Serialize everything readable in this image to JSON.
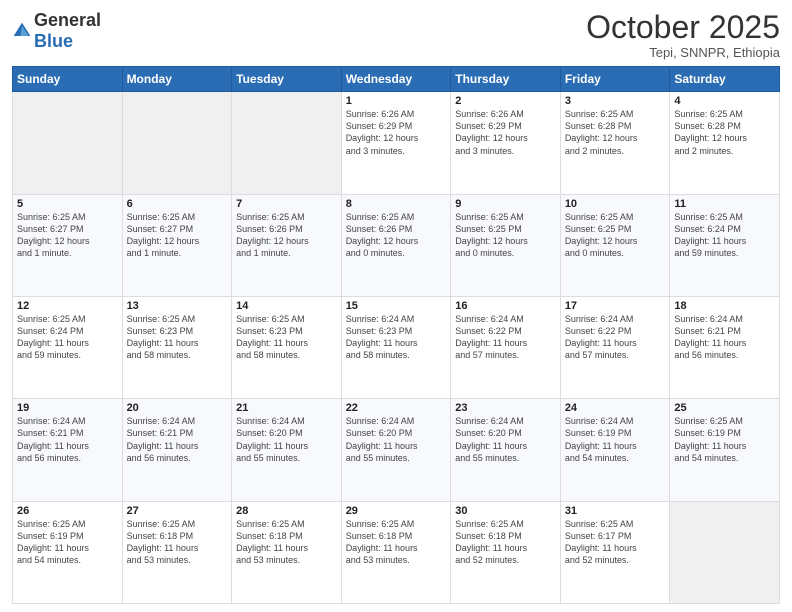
{
  "logo": {
    "general": "General",
    "blue": "Blue"
  },
  "header": {
    "month": "October 2025",
    "location": "Tepi, SNNPR, Ethiopia"
  },
  "days_of_week": [
    "Sunday",
    "Monday",
    "Tuesday",
    "Wednesday",
    "Thursday",
    "Friday",
    "Saturday"
  ],
  "weeks": [
    [
      {
        "day": "",
        "info": ""
      },
      {
        "day": "",
        "info": ""
      },
      {
        "day": "",
        "info": ""
      },
      {
        "day": "1",
        "info": "Sunrise: 6:26 AM\nSunset: 6:29 PM\nDaylight: 12 hours\nand 3 minutes."
      },
      {
        "day": "2",
        "info": "Sunrise: 6:26 AM\nSunset: 6:29 PM\nDaylight: 12 hours\nand 3 minutes."
      },
      {
        "day": "3",
        "info": "Sunrise: 6:25 AM\nSunset: 6:28 PM\nDaylight: 12 hours\nand 2 minutes."
      },
      {
        "day": "4",
        "info": "Sunrise: 6:25 AM\nSunset: 6:28 PM\nDaylight: 12 hours\nand 2 minutes."
      }
    ],
    [
      {
        "day": "5",
        "info": "Sunrise: 6:25 AM\nSunset: 6:27 PM\nDaylight: 12 hours\nand 1 minute."
      },
      {
        "day": "6",
        "info": "Sunrise: 6:25 AM\nSunset: 6:27 PM\nDaylight: 12 hours\nand 1 minute."
      },
      {
        "day": "7",
        "info": "Sunrise: 6:25 AM\nSunset: 6:26 PM\nDaylight: 12 hours\nand 1 minute."
      },
      {
        "day": "8",
        "info": "Sunrise: 6:25 AM\nSunset: 6:26 PM\nDaylight: 12 hours\nand 0 minutes."
      },
      {
        "day": "9",
        "info": "Sunrise: 6:25 AM\nSunset: 6:25 PM\nDaylight: 12 hours\nand 0 minutes."
      },
      {
        "day": "10",
        "info": "Sunrise: 6:25 AM\nSunset: 6:25 PM\nDaylight: 12 hours\nand 0 minutes."
      },
      {
        "day": "11",
        "info": "Sunrise: 6:25 AM\nSunset: 6:24 PM\nDaylight: 11 hours\nand 59 minutes."
      }
    ],
    [
      {
        "day": "12",
        "info": "Sunrise: 6:25 AM\nSunset: 6:24 PM\nDaylight: 11 hours\nand 59 minutes."
      },
      {
        "day": "13",
        "info": "Sunrise: 6:25 AM\nSunset: 6:23 PM\nDaylight: 11 hours\nand 58 minutes."
      },
      {
        "day": "14",
        "info": "Sunrise: 6:25 AM\nSunset: 6:23 PM\nDaylight: 11 hours\nand 58 minutes."
      },
      {
        "day": "15",
        "info": "Sunrise: 6:24 AM\nSunset: 6:23 PM\nDaylight: 11 hours\nand 58 minutes."
      },
      {
        "day": "16",
        "info": "Sunrise: 6:24 AM\nSunset: 6:22 PM\nDaylight: 11 hours\nand 57 minutes."
      },
      {
        "day": "17",
        "info": "Sunrise: 6:24 AM\nSunset: 6:22 PM\nDaylight: 11 hours\nand 57 minutes."
      },
      {
        "day": "18",
        "info": "Sunrise: 6:24 AM\nSunset: 6:21 PM\nDaylight: 11 hours\nand 56 minutes."
      }
    ],
    [
      {
        "day": "19",
        "info": "Sunrise: 6:24 AM\nSunset: 6:21 PM\nDaylight: 11 hours\nand 56 minutes."
      },
      {
        "day": "20",
        "info": "Sunrise: 6:24 AM\nSunset: 6:21 PM\nDaylight: 11 hours\nand 56 minutes."
      },
      {
        "day": "21",
        "info": "Sunrise: 6:24 AM\nSunset: 6:20 PM\nDaylight: 11 hours\nand 55 minutes."
      },
      {
        "day": "22",
        "info": "Sunrise: 6:24 AM\nSunset: 6:20 PM\nDaylight: 11 hours\nand 55 minutes."
      },
      {
        "day": "23",
        "info": "Sunrise: 6:24 AM\nSunset: 6:20 PM\nDaylight: 11 hours\nand 55 minutes."
      },
      {
        "day": "24",
        "info": "Sunrise: 6:24 AM\nSunset: 6:19 PM\nDaylight: 11 hours\nand 54 minutes."
      },
      {
        "day": "25",
        "info": "Sunrise: 6:25 AM\nSunset: 6:19 PM\nDaylight: 11 hours\nand 54 minutes."
      }
    ],
    [
      {
        "day": "26",
        "info": "Sunrise: 6:25 AM\nSunset: 6:19 PM\nDaylight: 11 hours\nand 54 minutes."
      },
      {
        "day": "27",
        "info": "Sunrise: 6:25 AM\nSunset: 6:18 PM\nDaylight: 11 hours\nand 53 minutes."
      },
      {
        "day": "28",
        "info": "Sunrise: 6:25 AM\nSunset: 6:18 PM\nDaylight: 11 hours\nand 53 minutes."
      },
      {
        "day": "29",
        "info": "Sunrise: 6:25 AM\nSunset: 6:18 PM\nDaylight: 11 hours\nand 53 minutes."
      },
      {
        "day": "30",
        "info": "Sunrise: 6:25 AM\nSunset: 6:18 PM\nDaylight: 11 hours\nand 52 minutes."
      },
      {
        "day": "31",
        "info": "Sunrise: 6:25 AM\nSunset: 6:17 PM\nDaylight: 11 hours\nand 52 minutes."
      },
      {
        "day": "",
        "info": ""
      }
    ]
  ]
}
